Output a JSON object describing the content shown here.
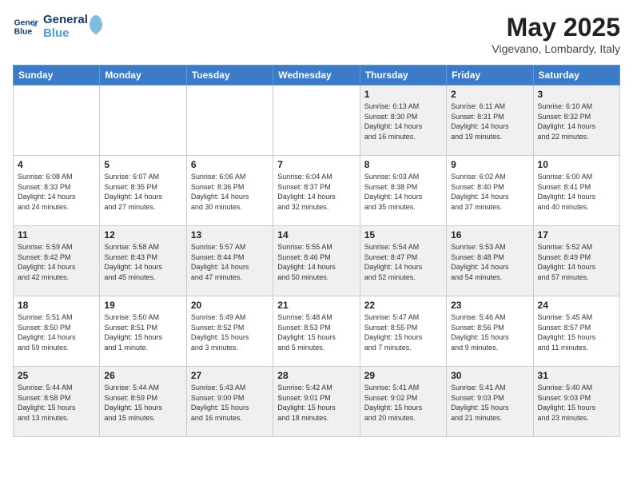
{
  "logo": {
    "line1": "General",
    "line2": "Blue"
  },
  "title": "May 2025",
  "location": "Vigevano, Lombardy, Italy",
  "weekdays": [
    "Sunday",
    "Monday",
    "Tuesday",
    "Wednesday",
    "Thursday",
    "Friday",
    "Saturday"
  ],
  "weeks": [
    [
      {
        "day": "",
        "info": ""
      },
      {
        "day": "",
        "info": ""
      },
      {
        "day": "",
        "info": ""
      },
      {
        "day": "",
        "info": ""
      },
      {
        "day": "1",
        "info": "Sunrise: 6:13 AM\nSunset: 8:30 PM\nDaylight: 14 hours\nand 16 minutes."
      },
      {
        "day": "2",
        "info": "Sunrise: 6:11 AM\nSunset: 8:31 PM\nDaylight: 14 hours\nand 19 minutes."
      },
      {
        "day": "3",
        "info": "Sunrise: 6:10 AM\nSunset: 8:32 PM\nDaylight: 14 hours\nand 22 minutes."
      }
    ],
    [
      {
        "day": "4",
        "info": "Sunrise: 6:08 AM\nSunset: 8:33 PM\nDaylight: 14 hours\nand 24 minutes."
      },
      {
        "day": "5",
        "info": "Sunrise: 6:07 AM\nSunset: 8:35 PM\nDaylight: 14 hours\nand 27 minutes."
      },
      {
        "day": "6",
        "info": "Sunrise: 6:06 AM\nSunset: 8:36 PM\nDaylight: 14 hours\nand 30 minutes."
      },
      {
        "day": "7",
        "info": "Sunrise: 6:04 AM\nSunset: 8:37 PM\nDaylight: 14 hours\nand 32 minutes."
      },
      {
        "day": "8",
        "info": "Sunrise: 6:03 AM\nSunset: 8:38 PM\nDaylight: 14 hours\nand 35 minutes."
      },
      {
        "day": "9",
        "info": "Sunrise: 6:02 AM\nSunset: 8:40 PM\nDaylight: 14 hours\nand 37 minutes."
      },
      {
        "day": "10",
        "info": "Sunrise: 6:00 AM\nSunset: 8:41 PM\nDaylight: 14 hours\nand 40 minutes."
      }
    ],
    [
      {
        "day": "11",
        "info": "Sunrise: 5:59 AM\nSunset: 8:42 PM\nDaylight: 14 hours\nand 42 minutes."
      },
      {
        "day": "12",
        "info": "Sunrise: 5:58 AM\nSunset: 8:43 PM\nDaylight: 14 hours\nand 45 minutes."
      },
      {
        "day": "13",
        "info": "Sunrise: 5:57 AM\nSunset: 8:44 PM\nDaylight: 14 hours\nand 47 minutes."
      },
      {
        "day": "14",
        "info": "Sunrise: 5:55 AM\nSunset: 8:46 PM\nDaylight: 14 hours\nand 50 minutes."
      },
      {
        "day": "15",
        "info": "Sunrise: 5:54 AM\nSunset: 8:47 PM\nDaylight: 14 hours\nand 52 minutes."
      },
      {
        "day": "16",
        "info": "Sunrise: 5:53 AM\nSunset: 8:48 PM\nDaylight: 14 hours\nand 54 minutes."
      },
      {
        "day": "17",
        "info": "Sunrise: 5:52 AM\nSunset: 8:49 PM\nDaylight: 14 hours\nand 57 minutes."
      }
    ],
    [
      {
        "day": "18",
        "info": "Sunrise: 5:51 AM\nSunset: 8:50 PM\nDaylight: 14 hours\nand 59 minutes."
      },
      {
        "day": "19",
        "info": "Sunrise: 5:50 AM\nSunset: 8:51 PM\nDaylight: 15 hours\nand 1 minute."
      },
      {
        "day": "20",
        "info": "Sunrise: 5:49 AM\nSunset: 8:52 PM\nDaylight: 15 hours\nand 3 minutes."
      },
      {
        "day": "21",
        "info": "Sunrise: 5:48 AM\nSunset: 8:53 PM\nDaylight: 15 hours\nand 5 minutes."
      },
      {
        "day": "22",
        "info": "Sunrise: 5:47 AM\nSunset: 8:55 PM\nDaylight: 15 hours\nand 7 minutes."
      },
      {
        "day": "23",
        "info": "Sunrise: 5:46 AM\nSunset: 8:56 PM\nDaylight: 15 hours\nand 9 minutes."
      },
      {
        "day": "24",
        "info": "Sunrise: 5:45 AM\nSunset: 8:57 PM\nDaylight: 15 hours\nand 11 minutes."
      }
    ],
    [
      {
        "day": "25",
        "info": "Sunrise: 5:44 AM\nSunset: 8:58 PM\nDaylight: 15 hours\nand 13 minutes."
      },
      {
        "day": "26",
        "info": "Sunrise: 5:44 AM\nSunset: 8:59 PM\nDaylight: 15 hours\nand 15 minutes."
      },
      {
        "day": "27",
        "info": "Sunrise: 5:43 AM\nSunset: 9:00 PM\nDaylight: 15 hours\nand 16 minutes."
      },
      {
        "day": "28",
        "info": "Sunrise: 5:42 AM\nSunset: 9:01 PM\nDaylight: 15 hours\nand 18 minutes."
      },
      {
        "day": "29",
        "info": "Sunrise: 5:41 AM\nSunset: 9:02 PM\nDaylight: 15 hours\nand 20 minutes."
      },
      {
        "day": "30",
        "info": "Sunrise: 5:41 AM\nSunset: 9:03 PM\nDaylight: 15 hours\nand 21 minutes."
      },
      {
        "day": "31",
        "info": "Sunrise: 5:40 AM\nSunset: 9:03 PM\nDaylight: 15 hours\nand 23 minutes."
      }
    ]
  ]
}
